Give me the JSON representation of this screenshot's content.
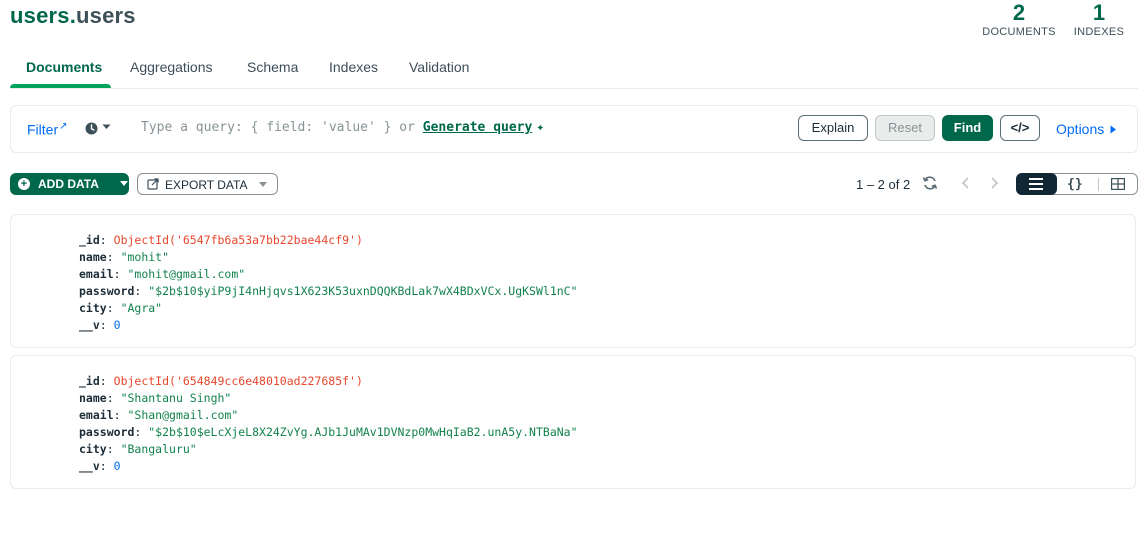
{
  "header": {
    "db_name": "users",
    "separator": ".",
    "collection_name": "users",
    "stats": [
      {
        "value": "2",
        "label": "DOCUMENTS"
      },
      {
        "value": "1",
        "label": "INDEXES"
      }
    ]
  },
  "tabs": [
    {
      "label": "Documents",
      "active": true
    },
    {
      "label": "Aggregations",
      "active": false
    },
    {
      "label": "Schema",
      "active": false
    },
    {
      "label": "Indexes",
      "active": false
    },
    {
      "label": "Validation",
      "active": false
    }
  ],
  "query_bar": {
    "filter_label": "Filter",
    "placeholder_text": "Type a query: { field: 'value' } or",
    "generate_label": "Generate query",
    "explain_label": "Explain",
    "reset_label": "Reset",
    "find_label": "Find",
    "code_label": "</>",
    "options_label": "Options"
  },
  "toolbar": {
    "add_data_label": "ADD DATA",
    "export_data_label": "EXPORT DATA",
    "pagination_text": "1 – 2 of 2",
    "json_view_label": "{}"
  },
  "documents": [
    {
      "fields": [
        {
          "key": "_id",
          "value": "ObjectId('6547fb6a53a7bb22bae44cf9')"
        },
        {
          "key": "name",
          "value": "\"mohit\""
        },
        {
          "key": "email",
          "value": "\"mohit@gmail.com\""
        },
        {
          "key": "password",
          "value": "\"$2b$10$yiP9jI4nHjqvs1X623K53uxnDQQKBdLak7wX4BDxVCx.UgKSWl1nC\""
        },
        {
          "key": "city",
          "value": "\"Agra\""
        },
        {
          "key": "__v",
          "value": "0"
        }
      ]
    },
    {
      "fields": [
        {
          "key": "_id",
          "value": "ObjectId('654849cc6e48010ad227685f')"
        },
        {
          "key": "name",
          "value": "\"Shantanu Singh\""
        },
        {
          "key": "email",
          "value": "\"Shan@gmail.com\""
        },
        {
          "key": "password",
          "value": "\"$2b$10$eLcXjeL8X24ZvYg.AJb1JuMAv1DVNzp0MwHqIaB2.unA5y.NTBaNa\""
        },
        {
          "key": "city",
          "value": "\"Bangaluru\""
        },
        {
          "key": "__v",
          "value": "0"
        }
      ]
    }
  ],
  "colors": {
    "brand_green": "#00684a",
    "tab_underline": "#00a35c",
    "link_blue": "#016bf8",
    "objectid": "#e8472c",
    "string": "#12824d",
    "number": "#016bf8"
  }
}
